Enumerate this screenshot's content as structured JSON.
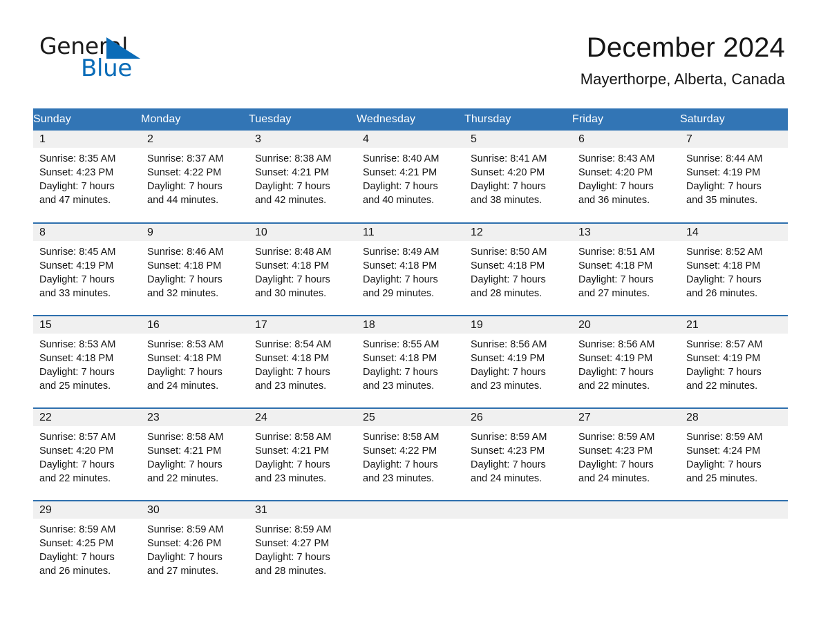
{
  "brand": {
    "name_part1": "General",
    "name_part2": "Blue",
    "accent_color": "#0a6cb8"
  },
  "header": {
    "title": "December 2024",
    "location": "Mayerthorpe, Alberta, Canada"
  },
  "theme": {
    "header_blue": "#3275b5",
    "row_divider_blue": "#2d6fad",
    "daynum_band_gray": "#f0f0f0",
    "text_color": "#161616"
  },
  "weekday_headers": [
    "Sunday",
    "Monday",
    "Tuesday",
    "Wednesday",
    "Thursday",
    "Friday",
    "Saturday"
  ],
  "labels": {
    "sunrise_prefix": "Sunrise:",
    "sunset_prefix": "Sunset:",
    "daylight_prefix": "Daylight:"
  },
  "weeks": [
    [
      {
        "day": "1",
        "sunrise": "Sunrise: 8:35 AM",
        "sunset": "Sunset: 4:23 PM",
        "daylight_line1": "Daylight: 7 hours",
        "daylight_line2": "and 47 minutes."
      },
      {
        "day": "2",
        "sunrise": "Sunrise: 8:37 AM",
        "sunset": "Sunset: 4:22 PM",
        "daylight_line1": "Daylight: 7 hours",
        "daylight_line2": "and 44 minutes."
      },
      {
        "day": "3",
        "sunrise": "Sunrise: 8:38 AM",
        "sunset": "Sunset: 4:21 PM",
        "daylight_line1": "Daylight: 7 hours",
        "daylight_line2": "and 42 minutes."
      },
      {
        "day": "4",
        "sunrise": "Sunrise: 8:40 AM",
        "sunset": "Sunset: 4:21 PM",
        "daylight_line1": "Daylight: 7 hours",
        "daylight_line2": "and 40 minutes."
      },
      {
        "day": "5",
        "sunrise": "Sunrise: 8:41 AM",
        "sunset": "Sunset: 4:20 PM",
        "daylight_line1": "Daylight: 7 hours",
        "daylight_line2": "and 38 minutes."
      },
      {
        "day": "6",
        "sunrise": "Sunrise: 8:43 AM",
        "sunset": "Sunset: 4:20 PM",
        "daylight_line1": "Daylight: 7 hours",
        "daylight_line2": "and 36 minutes."
      },
      {
        "day": "7",
        "sunrise": "Sunrise: 8:44 AM",
        "sunset": "Sunset: 4:19 PM",
        "daylight_line1": "Daylight: 7 hours",
        "daylight_line2": "and 35 minutes."
      }
    ],
    [
      {
        "day": "8",
        "sunrise": "Sunrise: 8:45 AM",
        "sunset": "Sunset: 4:19 PM",
        "daylight_line1": "Daylight: 7 hours",
        "daylight_line2": "and 33 minutes."
      },
      {
        "day": "9",
        "sunrise": "Sunrise: 8:46 AM",
        "sunset": "Sunset: 4:18 PM",
        "daylight_line1": "Daylight: 7 hours",
        "daylight_line2": "and 32 minutes."
      },
      {
        "day": "10",
        "sunrise": "Sunrise: 8:48 AM",
        "sunset": "Sunset: 4:18 PM",
        "daylight_line1": "Daylight: 7 hours",
        "daylight_line2": "and 30 minutes."
      },
      {
        "day": "11",
        "sunrise": "Sunrise: 8:49 AM",
        "sunset": "Sunset: 4:18 PM",
        "daylight_line1": "Daylight: 7 hours",
        "daylight_line2": "and 29 minutes."
      },
      {
        "day": "12",
        "sunrise": "Sunrise: 8:50 AM",
        "sunset": "Sunset: 4:18 PM",
        "daylight_line1": "Daylight: 7 hours",
        "daylight_line2": "and 28 minutes."
      },
      {
        "day": "13",
        "sunrise": "Sunrise: 8:51 AM",
        "sunset": "Sunset: 4:18 PM",
        "daylight_line1": "Daylight: 7 hours",
        "daylight_line2": "and 27 minutes."
      },
      {
        "day": "14",
        "sunrise": "Sunrise: 8:52 AM",
        "sunset": "Sunset: 4:18 PM",
        "daylight_line1": "Daylight: 7 hours",
        "daylight_line2": "and 26 minutes."
      }
    ],
    [
      {
        "day": "15",
        "sunrise": "Sunrise: 8:53 AM",
        "sunset": "Sunset: 4:18 PM",
        "daylight_line1": "Daylight: 7 hours",
        "daylight_line2": "and 25 minutes."
      },
      {
        "day": "16",
        "sunrise": "Sunrise: 8:53 AM",
        "sunset": "Sunset: 4:18 PM",
        "daylight_line1": "Daylight: 7 hours",
        "daylight_line2": "and 24 minutes."
      },
      {
        "day": "17",
        "sunrise": "Sunrise: 8:54 AM",
        "sunset": "Sunset: 4:18 PM",
        "daylight_line1": "Daylight: 7 hours",
        "daylight_line2": "and 23 minutes."
      },
      {
        "day": "18",
        "sunrise": "Sunrise: 8:55 AM",
        "sunset": "Sunset: 4:18 PM",
        "daylight_line1": "Daylight: 7 hours",
        "daylight_line2": "and 23 minutes."
      },
      {
        "day": "19",
        "sunrise": "Sunrise: 8:56 AM",
        "sunset": "Sunset: 4:19 PM",
        "daylight_line1": "Daylight: 7 hours",
        "daylight_line2": "and 23 minutes."
      },
      {
        "day": "20",
        "sunrise": "Sunrise: 8:56 AM",
        "sunset": "Sunset: 4:19 PM",
        "daylight_line1": "Daylight: 7 hours",
        "daylight_line2": "and 22 minutes."
      },
      {
        "day": "21",
        "sunrise": "Sunrise: 8:57 AM",
        "sunset": "Sunset: 4:19 PM",
        "daylight_line1": "Daylight: 7 hours",
        "daylight_line2": "and 22 minutes."
      }
    ],
    [
      {
        "day": "22",
        "sunrise": "Sunrise: 8:57 AM",
        "sunset": "Sunset: 4:20 PM",
        "daylight_line1": "Daylight: 7 hours",
        "daylight_line2": "and 22 minutes."
      },
      {
        "day": "23",
        "sunrise": "Sunrise: 8:58 AM",
        "sunset": "Sunset: 4:21 PM",
        "daylight_line1": "Daylight: 7 hours",
        "daylight_line2": "and 22 minutes."
      },
      {
        "day": "24",
        "sunrise": "Sunrise: 8:58 AM",
        "sunset": "Sunset: 4:21 PM",
        "daylight_line1": "Daylight: 7 hours",
        "daylight_line2": "and 23 minutes."
      },
      {
        "day": "25",
        "sunrise": "Sunrise: 8:58 AM",
        "sunset": "Sunset: 4:22 PM",
        "daylight_line1": "Daylight: 7 hours",
        "daylight_line2": "and 23 minutes."
      },
      {
        "day": "26",
        "sunrise": "Sunrise: 8:59 AM",
        "sunset": "Sunset: 4:23 PM",
        "daylight_line1": "Daylight: 7 hours",
        "daylight_line2": "and 24 minutes."
      },
      {
        "day": "27",
        "sunrise": "Sunrise: 8:59 AM",
        "sunset": "Sunset: 4:23 PM",
        "daylight_line1": "Daylight: 7 hours",
        "daylight_line2": "and 24 minutes."
      },
      {
        "day": "28",
        "sunrise": "Sunrise: 8:59 AM",
        "sunset": "Sunset: 4:24 PM",
        "daylight_line1": "Daylight: 7 hours",
        "daylight_line2": "and 25 minutes."
      }
    ],
    [
      {
        "day": "29",
        "sunrise": "Sunrise: 8:59 AM",
        "sunset": "Sunset: 4:25 PM",
        "daylight_line1": "Daylight: 7 hours",
        "daylight_line2": "and 26 minutes."
      },
      {
        "day": "30",
        "sunrise": "Sunrise: 8:59 AM",
        "sunset": "Sunset: 4:26 PM",
        "daylight_line1": "Daylight: 7 hours",
        "daylight_line2": "and 27 minutes."
      },
      {
        "day": "31",
        "sunrise": "Sunrise: 8:59 AM",
        "sunset": "Sunset: 4:27 PM",
        "daylight_line1": "Daylight: 7 hours",
        "daylight_line2": "and 28 minutes."
      },
      {
        "day": "",
        "sunrise": "",
        "sunset": "",
        "daylight_line1": "",
        "daylight_line2": ""
      },
      {
        "day": "",
        "sunrise": "",
        "sunset": "",
        "daylight_line1": "",
        "daylight_line2": ""
      },
      {
        "day": "",
        "sunrise": "",
        "sunset": "",
        "daylight_line1": "",
        "daylight_line2": ""
      },
      {
        "day": "",
        "sunrise": "",
        "sunset": "",
        "daylight_line1": "",
        "daylight_line2": ""
      }
    ]
  ]
}
